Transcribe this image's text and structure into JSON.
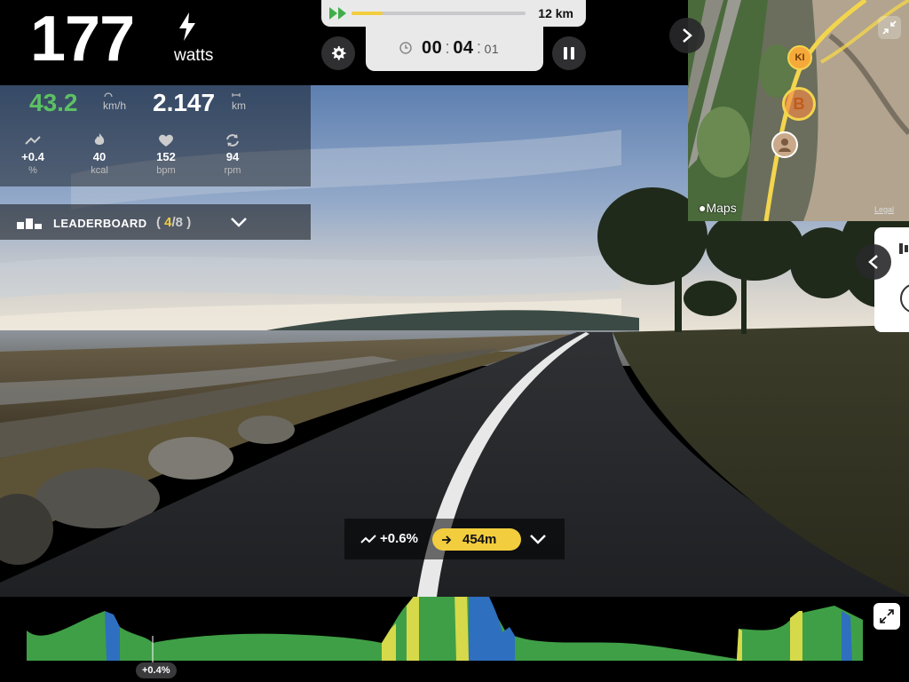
{
  "header": {
    "power_value": "177",
    "power_unit": "watts",
    "bolt_icon": "bolt-icon",
    "route_progress": 0.18,
    "route_total": "12 km",
    "time_hours": "00",
    "time_minutes": "04",
    "time_fraction": "01",
    "settings_icon": "gear-icon",
    "pause_icon": "pause-icon"
  },
  "stats": {
    "speed_value": "43.2",
    "speed_unit": "km/h",
    "distance_value": "2.147",
    "distance_unit": "km",
    "grade_value": "+0.4",
    "grade_unit": "%",
    "calories_value": "40",
    "calories_unit": "kcal",
    "heart_rate_value": "152",
    "heart_rate_unit": "bpm",
    "cadence_value": "94",
    "cadence_unit": "rpm",
    "speed_color": "#5cc163"
  },
  "leaderboard": {
    "title": "LEADERBOARD",
    "position": "4",
    "total": "/8",
    "accent_color": "#f2cd3e"
  },
  "map": {
    "brand": "Maps",
    "legal": "Legal",
    "marker_initials": "KI",
    "marker_b": "B"
  },
  "gradebar": {
    "grade": "+0.6%",
    "distance_ahead": "454m"
  },
  "elevation": {
    "tag": "+0.4%",
    "profile_colors": [
      "#3f9f46",
      "#d6d94a",
      "#2f6fbf"
    ]
  }
}
